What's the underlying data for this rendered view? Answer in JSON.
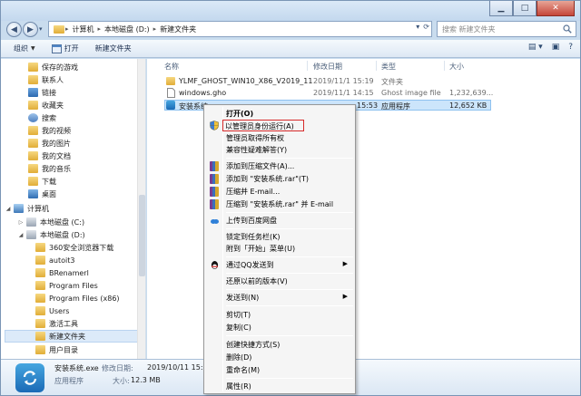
{
  "colors": {
    "selection": "#cce5fb",
    "highlight_border": "#d62a2a",
    "window_frame": "#c9dcee",
    "folder": "#e9b847"
  },
  "address_bar": {
    "crumbs": [
      "计算机",
      "本地磁盘 (D:)",
      "新建文件夹"
    ],
    "search_placeholder": "搜索 新建文件夹"
  },
  "command_bar": {
    "organize_label": "组织",
    "open_label": "打开",
    "new_folder_label": "新建文件夹"
  },
  "sidebar": {
    "items": [
      {
        "label": "保存的游戏",
        "icon": "saved-games-icon",
        "selected": false
      },
      {
        "label": "联系人",
        "icon": "contacts-icon",
        "selected": false
      },
      {
        "label": "链接",
        "icon": "links-icon",
        "selected": false
      },
      {
        "label": "收藏夹",
        "icon": "favorites-icon",
        "selected": false
      },
      {
        "label": "搜索",
        "icon": "searches-icon",
        "selected": false
      },
      {
        "label": "我的视频",
        "icon": "videos-icon",
        "selected": false
      },
      {
        "label": "我的图片",
        "icon": "pictures-icon",
        "selected": false
      },
      {
        "label": "我的文档",
        "icon": "documents-icon",
        "selected": false
      },
      {
        "label": "我的音乐",
        "icon": "music-icon",
        "selected": false
      },
      {
        "label": "下载",
        "icon": "downloads-icon",
        "selected": false
      },
      {
        "label": "桌面",
        "icon": "desktop-icon",
        "selected": false
      },
      {
        "label": "计算机",
        "icon": "computer-icon",
        "selected": false
      },
      {
        "label": "本地磁盘 (C:)",
        "icon": "drive-icon",
        "selected": false
      },
      {
        "label": "本地磁盘 (D:)",
        "icon": "drive-icon",
        "selected": false
      },
      {
        "label": "360安全浏览器下载",
        "icon": "folder-icon",
        "selected": false
      },
      {
        "label": "autoit3",
        "icon": "folder-icon",
        "selected": false
      },
      {
        "label": "BRenamerl",
        "icon": "folder-icon",
        "selected": false
      },
      {
        "label": "Program Files",
        "icon": "folder-icon",
        "selected": false
      },
      {
        "label": "Program Files (x86)",
        "icon": "folder-icon",
        "selected": false
      },
      {
        "label": "Users",
        "icon": "folder-icon",
        "selected": false
      },
      {
        "label": "激活工具",
        "icon": "folder-icon",
        "selected": false
      },
      {
        "label": "新建文件夹",
        "icon": "folder-icon",
        "selected": true
      },
      {
        "label": "用户目录",
        "icon": "folder-icon",
        "selected": false
      }
    ]
  },
  "file_list": {
    "columns": {
      "name": "名称",
      "modified": "修改日期",
      "type": "类型",
      "size": "大小"
    },
    "rows": [
      {
        "name": "YLMF_GHOST_WIN10_X86_V2019_11",
        "modified": "2019/11/1 15:19",
        "type": "文件夹",
        "size": "",
        "icon": "folder-icon",
        "selected": false
      },
      {
        "name": "windows.gho",
        "modified": "2019/11/1 14:15",
        "type": "Ghost image file",
        "size": "1,232,639...",
        "icon": "file-icon",
        "selected": false
      },
      {
        "name": "安装系统...",
        "modified": "15:53",
        "type": "应用程序",
        "size": "12,652 KB",
        "icon": "installer-icon",
        "selected": true
      }
    ]
  },
  "context_menu": {
    "items": [
      {
        "label": "打开(O)",
        "bold": true
      },
      {
        "label": "以管理员身份运行(A)",
        "icon": "shield-icon",
        "highlight": true
      },
      {
        "label": "管理员取得所有权"
      },
      {
        "label": "兼容性疑难解答(Y)"
      },
      {
        "label": "添加到压缩文件(A)...",
        "icon": "rar-icon"
      },
      {
        "label": "添加到 \"安装系统.rar\"(T)",
        "icon": "rar-icon"
      },
      {
        "label": "压缩并 E-mail...",
        "icon": "rar-icon"
      },
      {
        "label": "压缩到 \"安装系统.rar\" 并 E-mail",
        "icon": "rar-icon"
      },
      {
        "label": "上传到百度网盘",
        "icon": "cloud-icon"
      },
      {
        "label": "锁定到任务栏(K)"
      },
      {
        "label": "附到「开始」菜单(U)"
      },
      {
        "label": "通过QQ发送到",
        "icon": "qq-icon",
        "submenu": true
      },
      {
        "label": "还原以前的版本(V)"
      },
      {
        "label": "发送到(N)",
        "submenu": true
      },
      {
        "label": "剪切(T)"
      },
      {
        "label": "复制(C)"
      },
      {
        "label": "创建快捷方式(S)"
      },
      {
        "label": "删除(D)"
      },
      {
        "label": "重命名(M)"
      },
      {
        "label": "属性(R)"
      }
    ]
  },
  "details": {
    "name": "安装系统.exe",
    "modified_label": "修改日期:",
    "modified_value": "2019/10/11 15:53",
    "type_value": "应用程序",
    "size_label": "大小:",
    "size_value": "12.3 MB"
  }
}
